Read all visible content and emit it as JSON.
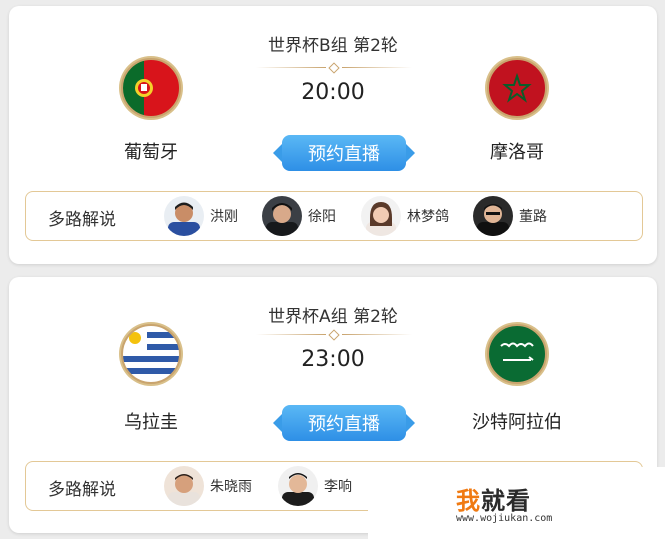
{
  "matches": [
    {
      "stage": "世界杯B组 第2轮",
      "time": "20:00",
      "home_team": "葡萄牙",
      "away_team": "摩洛哥",
      "home_flag_icon": "portugal-flag-icon",
      "away_flag_icon": "morocco-flag-icon",
      "button_label": "预约直播",
      "commentary_label": "多路解说",
      "commentators": [
        "洪刚",
        "徐阳",
        "林梦鸽",
        "董路"
      ]
    },
    {
      "stage": "世界杯A组 第2轮",
      "time": "23:00",
      "home_team": "乌拉圭",
      "away_team": "沙特阿拉伯",
      "home_flag_icon": "uruguay-flag-icon",
      "away_flag_icon": "saudi-arabia-flag-icon",
      "button_label": "预约直播",
      "commentary_label": "多路解说",
      "commentators": [
        "朱晓雨",
        "李响"
      ]
    }
  ],
  "watermark": {
    "title_accent": "我",
    "title_rest": "就看",
    "url": "www.wojiukan.com"
  },
  "colors": {
    "button_blue": "#2e8fe6",
    "gold_border": "#e3c896",
    "flag_rim": "#c9a46e"
  }
}
